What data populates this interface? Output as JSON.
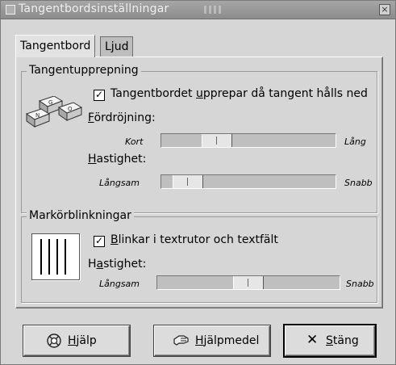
{
  "window": {
    "title": "Tangentbordsinställningar",
    "close_glyph": "×"
  },
  "tabs": [
    {
      "label": "Tangentbord",
      "active": true
    },
    {
      "label": "Ljud",
      "active": false
    }
  ],
  "repeat": {
    "frame_label": "Tangentupprepning",
    "checkbox_checked": true,
    "checkbox_mark": "✓",
    "checkbox_pre": "Tangentbordet ",
    "checkbox_u": "u",
    "checkbox_post": "pprepar då tangent hålls ned",
    "delay_label_u": "F",
    "delay_label_rest": "ördröjning:",
    "delay_min": "Kort",
    "delay_max": "Lång",
    "delay_value": 0.28,
    "speed_label_u": "H",
    "speed_label_rest": "astighet:",
    "speed_min": "Långsam",
    "speed_max": "Snabb",
    "speed_value": 0.08,
    "key_letters": [
      "G",
      "O",
      "N"
    ]
  },
  "cursor": {
    "frame_label": "Markörblinkningar",
    "checkbox_checked": true,
    "checkbox_mark": "✓",
    "checkbox_u": "B",
    "checkbox_rest": "linkar i textrutor och textfält",
    "speed_label_pre": "H",
    "speed_label_u": "a",
    "speed_label_rest": "stighet:",
    "speed_min": "Långsam",
    "speed_max": "Snabb",
    "speed_value": 0.5
  },
  "buttons": {
    "help_u": "H",
    "help_rest": "jälp",
    "assist_u": "H",
    "assist_rest": "jälpmedel",
    "close_glyph": "✕",
    "close_u": "S",
    "close_rest": "täng"
  }
}
